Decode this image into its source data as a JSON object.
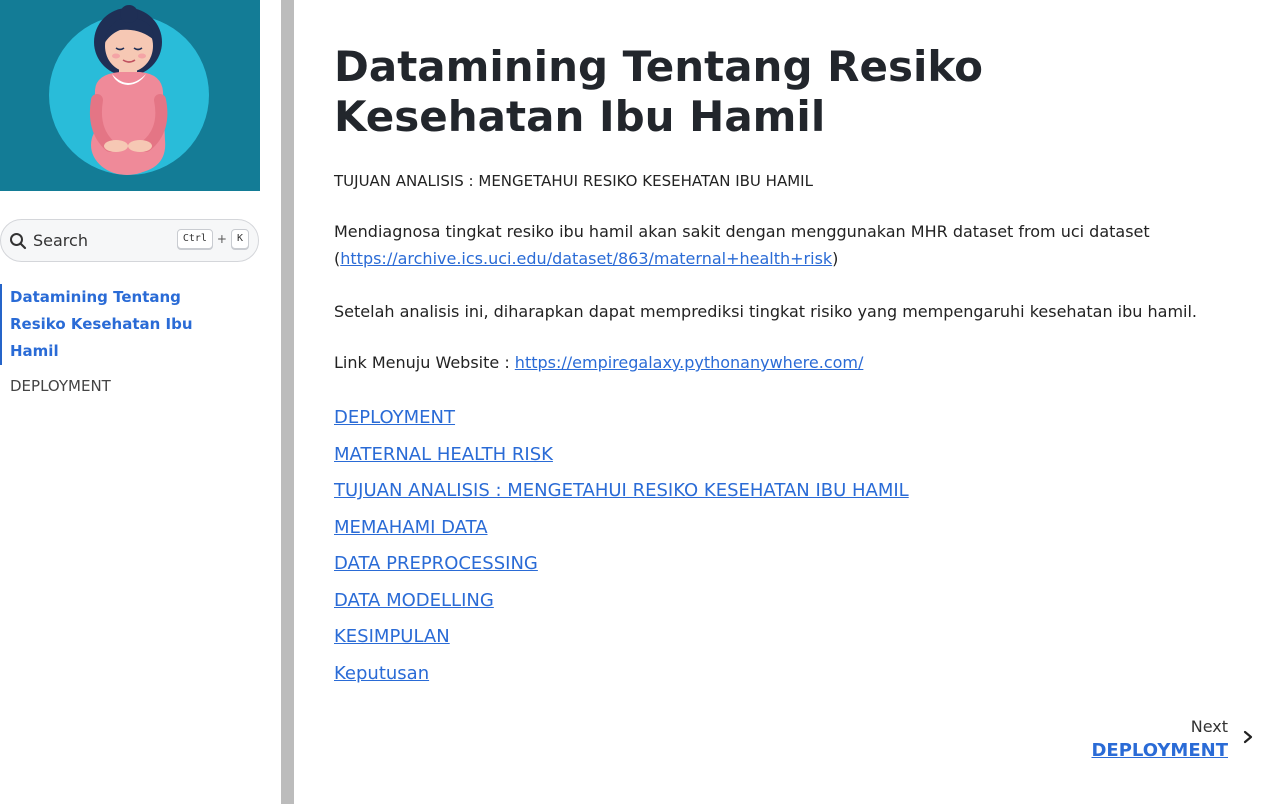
{
  "sidebar": {
    "search": {
      "label": "Search",
      "key1": "Ctrl",
      "plus": "+",
      "key2": "K"
    },
    "items": [
      {
        "label": "Datamining Tentang Resiko Kesehatan Ibu Hamil",
        "active": true
      },
      {
        "label": "DEPLOYMENT",
        "active": false
      }
    ]
  },
  "main": {
    "title": "Datamining Tentang Resiko Kesehatan Ibu Hamil",
    "goal": "TUJUAN ANALISIS : MENGETAHUI RESIKO KESEHATAN IBU HAMIL",
    "intro_text": "Mendiagnosa tingkat resiko ibu hamil akan sakit dengan menggunakan MHR dataset from uci dataset",
    "intro_link_open": "(",
    "intro_link": "https://archive.ics.uci.edu/dataset/863/maternal+health+risk",
    "intro_link_close": ")",
    "outcome": "Setelah analisis ini, diharapkan dapat memprediksi tingkat risiko yang mempengaruhi kesehatan ibu hamil.",
    "website_label": "Link Menuju Website : ",
    "website_link": "https://empiregalaxy.pythonanywhere.com/",
    "toc": [
      "DEPLOYMENT",
      "MATERNAL HEALTH RISK",
      "TUJUAN ANALISIS : MENGETAHUI RESIKO KESEHATAN IBU HAMIL",
      "MEMAHAMI DATA",
      "DATA PREPROCESSING",
      "DATA MODELLING",
      "KESIMPULAN",
      "Keputusan"
    ],
    "next": {
      "label": "Next",
      "title": "DEPLOYMENT"
    }
  },
  "colors": {
    "accent": "#2a6bd6",
    "logo_bg": "#137c96",
    "circle": "#29bcd9",
    "dress": "#ef8a99"
  }
}
